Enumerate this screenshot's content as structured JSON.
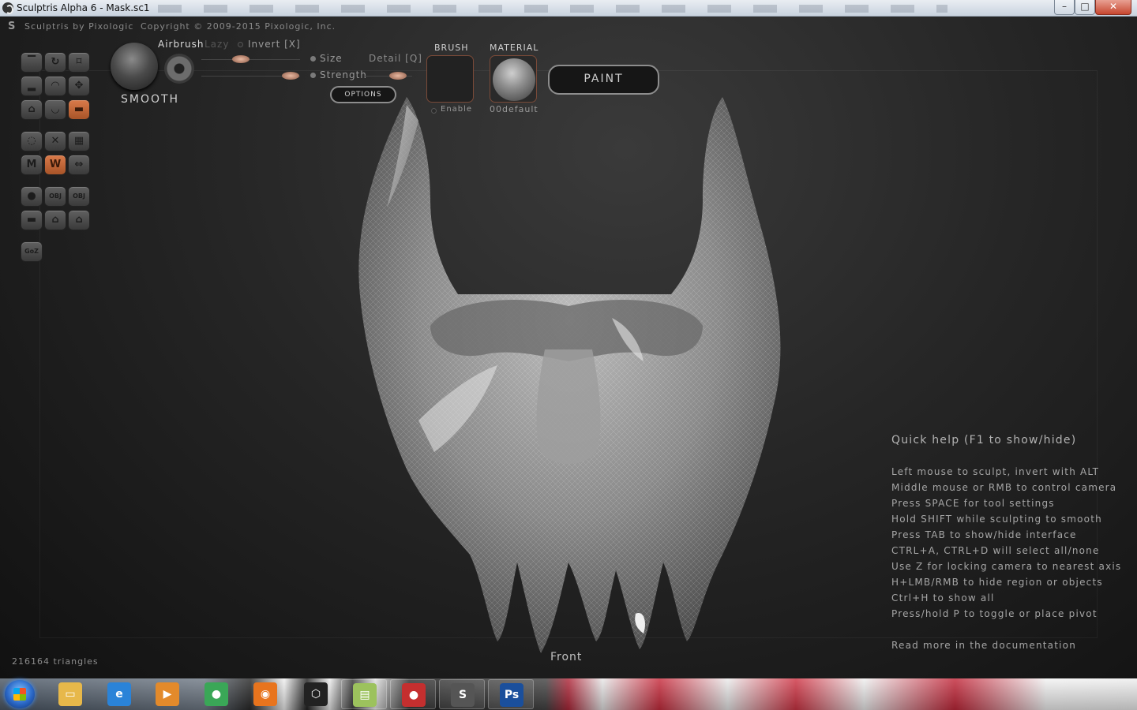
{
  "window": {
    "title": "Sculptris Alpha 6 - Mask.sc1",
    "min_glyph": "–",
    "max_glyph": "□",
    "close_glyph": "✕"
  },
  "app": {
    "brand": "Sculptris by Pixologic",
    "copyright": "Copyright © 2009-2015 Pixologic, Inc."
  },
  "tool_grid": {
    "buttons": [
      {
        "name": "draw-tool",
        "glyph": "▔"
      },
      {
        "name": "rotate-tool",
        "glyph": "↻"
      },
      {
        "name": "crop-tool",
        "glyph": "⌑"
      },
      {
        "name": "flatten-tool",
        "glyph": "▂"
      },
      {
        "name": "inflate-tool",
        "glyph": "◠"
      },
      {
        "name": "move-tool",
        "glyph": "✥"
      },
      {
        "name": "pinch-tool",
        "glyph": "⌂"
      },
      {
        "name": "crease-tool",
        "glyph": "◡"
      },
      {
        "name": "smooth-tool",
        "glyph": "▬"
      },
      {
        "name": "sphere-tool",
        "glyph": "◌"
      },
      {
        "name": "symmetry-off-tool",
        "glyph": "✕"
      },
      {
        "name": "grid-tool",
        "glyph": "▦"
      },
      {
        "name": "wireframe-tool",
        "glyph": "M"
      },
      {
        "name": "symmetry-tool",
        "glyph": "W"
      },
      {
        "name": "mirror-tool",
        "glyph": "⇔"
      },
      {
        "name": "new-sphere-tool",
        "glyph": "●"
      },
      {
        "name": "import-obj-tool",
        "glyph": "OBJ"
      },
      {
        "name": "export-obj-tool",
        "glyph": "OBJ"
      },
      {
        "name": "new-plane-tool",
        "glyph": "▬"
      },
      {
        "name": "open-tool",
        "glyph": "⌂"
      },
      {
        "name": "save-tool",
        "glyph": "⌂"
      },
      {
        "name": "goz-tool",
        "glyph": "GoZ"
      }
    ]
  },
  "brush_panel": {
    "tool_name": "SMOOTH",
    "airbrush_label": "Airbrush",
    "lazy_label": "Lazy",
    "invert_label": "Invert [X]",
    "size_label": "Size",
    "detail_label": "Detail [Q]",
    "strength_label": "Strength",
    "options_label": "OPTIONS",
    "size_value": 0.4,
    "strength_value": 0.9,
    "detail_value": 0.7
  },
  "brush_slot": {
    "header": "BRUSH",
    "enable_label": "Enable"
  },
  "material_slot": {
    "header": "MATERIAL",
    "name": "00default"
  },
  "paint_button": "PAINT",
  "quick_help": {
    "title": "Quick help (F1 to show/hide)",
    "lines": [
      "Left mouse to sculpt, invert with ALT",
      "Middle mouse or RMB to control camera",
      "Press SPACE for tool settings",
      "Hold SHIFT while sculpting to smooth",
      "Press TAB to show/hide interface",
      "CTRL+A, CTRL+D will select all/none",
      "Use Z for locking camera to nearest axis",
      "H+LMB/RMB to hide region or objects",
      "Ctrl+H to show all",
      "Press/hold P to toggle or place pivot"
    ],
    "more": "Read more in the documentation"
  },
  "view_label": "Front",
  "triangle_count": "216164 triangles",
  "taskbar": {
    "items": [
      {
        "name": "explorer-taskbar",
        "glyph": "▭",
        "color": "#e7b84a"
      },
      {
        "name": "internet-explorer-taskbar",
        "glyph": "e",
        "color": "#2a83d8"
      },
      {
        "name": "media-player-taskbar",
        "glyph": "▶",
        "color": "#e38a2b"
      },
      {
        "name": "chrome-taskbar",
        "glyph": "●",
        "color": "#3aa757"
      },
      {
        "name": "firefox-taskbar",
        "glyph": "◉",
        "color": "#e8741d"
      },
      {
        "name": "unity-taskbar",
        "glyph": "⬡",
        "color": "#222222"
      },
      {
        "name": "notes-taskbar",
        "glyph": "▤",
        "color": "#9cc25d"
      },
      {
        "name": "chrome-app-taskbar",
        "glyph": "●",
        "color": "#c42f2f"
      },
      {
        "name": "sculptris-taskbar",
        "glyph": "S",
        "color": "#555555"
      },
      {
        "name": "photoshop-taskbar",
        "glyph": "Ps",
        "color": "#1a4f9c"
      }
    ]
  }
}
